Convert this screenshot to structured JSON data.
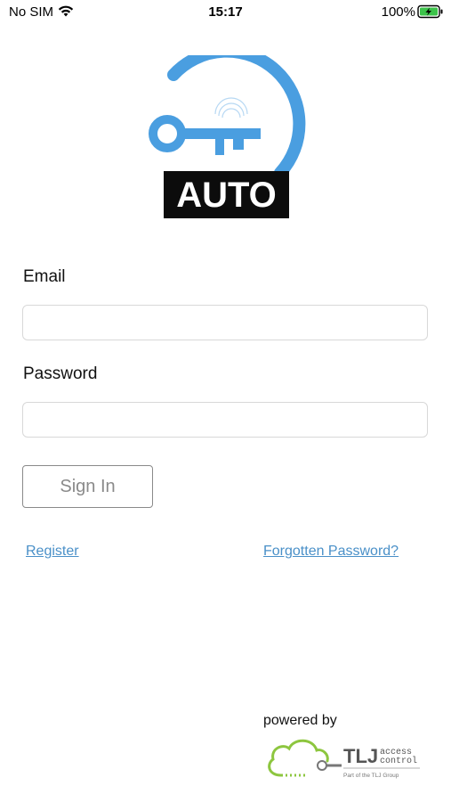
{
  "status_bar": {
    "carrier": "No SIM",
    "time": "15:17",
    "battery": "100%",
    "icons": [
      "wifi-icon",
      "battery-charging-icon"
    ]
  },
  "logo": {
    "text": "AUTO",
    "icon": "key-icon",
    "colors": {
      "accent": "#4a9ee0",
      "badge": "#0c0c0c",
      "badge_text": "#ffffff"
    }
  },
  "login_form": {
    "email_label": "Email",
    "email_value": "",
    "password_label": "Password",
    "password_value": "",
    "sign_in_label": "Sign In"
  },
  "links": {
    "register": "Register",
    "forgot_password": "Forgotten Password?",
    "color": "#4a90c8"
  },
  "footer": {
    "powered_by": "powered by",
    "brand_name": "TLJ",
    "brand_line1": "access",
    "brand_line2": "control",
    "brand_tagline": "Part of the TLJ Group",
    "brand_icon": "cloud-key-icon",
    "colors": {
      "cloud": "#8dc63f",
      "text": "#555555"
    }
  }
}
